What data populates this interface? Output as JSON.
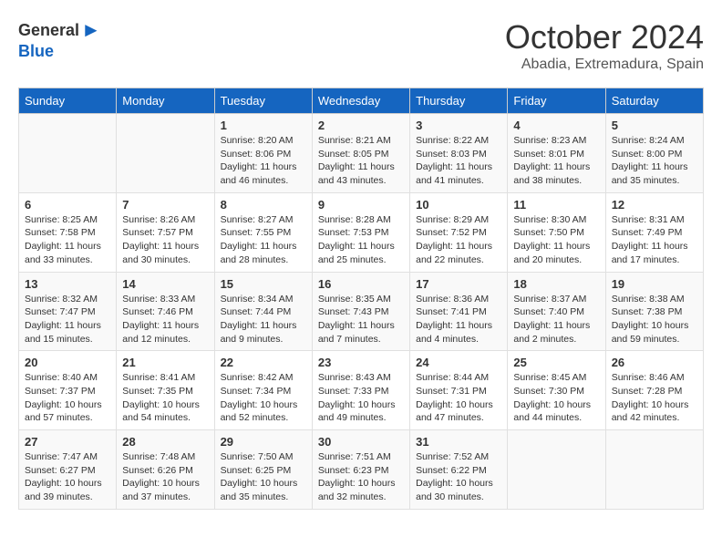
{
  "header": {
    "logo_general": "General",
    "logo_blue": "Blue",
    "month": "October 2024",
    "location": "Abadia, Extremadura, Spain"
  },
  "weekdays": [
    "Sunday",
    "Monday",
    "Tuesday",
    "Wednesday",
    "Thursday",
    "Friday",
    "Saturday"
  ],
  "weeks": [
    [
      {
        "day": "",
        "text": ""
      },
      {
        "day": "",
        "text": ""
      },
      {
        "day": "1",
        "text": "Sunrise: 8:20 AM\nSunset: 8:06 PM\nDaylight: 11 hours and 46 minutes."
      },
      {
        "day": "2",
        "text": "Sunrise: 8:21 AM\nSunset: 8:05 PM\nDaylight: 11 hours and 43 minutes."
      },
      {
        "day": "3",
        "text": "Sunrise: 8:22 AM\nSunset: 8:03 PM\nDaylight: 11 hours and 41 minutes."
      },
      {
        "day": "4",
        "text": "Sunrise: 8:23 AM\nSunset: 8:01 PM\nDaylight: 11 hours and 38 minutes."
      },
      {
        "day": "5",
        "text": "Sunrise: 8:24 AM\nSunset: 8:00 PM\nDaylight: 11 hours and 35 minutes."
      }
    ],
    [
      {
        "day": "6",
        "text": "Sunrise: 8:25 AM\nSunset: 7:58 PM\nDaylight: 11 hours and 33 minutes."
      },
      {
        "day": "7",
        "text": "Sunrise: 8:26 AM\nSunset: 7:57 PM\nDaylight: 11 hours and 30 minutes."
      },
      {
        "day": "8",
        "text": "Sunrise: 8:27 AM\nSunset: 7:55 PM\nDaylight: 11 hours and 28 minutes."
      },
      {
        "day": "9",
        "text": "Sunrise: 8:28 AM\nSunset: 7:53 PM\nDaylight: 11 hours and 25 minutes."
      },
      {
        "day": "10",
        "text": "Sunrise: 8:29 AM\nSunset: 7:52 PM\nDaylight: 11 hours and 22 minutes."
      },
      {
        "day": "11",
        "text": "Sunrise: 8:30 AM\nSunset: 7:50 PM\nDaylight: 11 hours and 20 minutes."
      },
      {
        "day": "12",
        "text": "Sunrise: 8:31 AM\nSunset: 7:49 PM\nDaylight: 11 hours and 17 minutes."
      }
    ],
    [
      {
        "day": "13",
        "text": "Sunrise: 8:32 AM\nSunset: 7:47 PM\nDaylight: 11 hours and 15 minutes."
      },
      {
        "day": "14",
        "text": "Sunrise: 8:33 AM\nSunset: 7:46 PM\nDaylight: 11 hours and 12 minutes."
      },
      {
        "day": "15",
        "text": "Sunrise: 8:34 AM\nSunset: 7:44 PM\nDaylight: 11 hours and 9 minutes."
      },
      {
        "day": "16",
        "text": "Sunrise: 8:35 AM\nSunset: 7:43 PM\nDaylight: 11 hours and 7 minutes."
      },
      {
        "day": "17",
        "text": "Sunrise: 8:36 AM\nSunset: 7:41 PM\nDaylight: 11 hours and 4 minutes."
      },
      {
        "day": "18",
        "text": "Sunrise: 8:37 AM\nSunset: 7:40 PM\nDaylight: 11 hours and 2 minutes."
      },
      {
        "day": "19",
        "text": "Sunrise: 8:38 AM\nSunset: 7:38 PM\nDaylight: 10 hours and 59 minutes."
      }
    ],
    [
      {
        "day": "20",
        "text": "Sunrise: 8:40 AM\nSunset: 7:37 PM\nDaylight: 10 hours and 57 minutes."
      },
      {
        "day": "21",
        "text": "Sunrise: 8:41 AM\nSunset: 7:35 PM\nDaylight: 10 hours and 54 minutes."
      },
      {
        "day": "22",
        "text": "Sunrise: 8:42 AM\nSunset: 7:34 PM\nDaylight: 10 hours and 52 minutes."
      },
      {
        "day": "23",
        "text": "Sunrise: 8:43 AM\nSunset: 7:33 PM\nDaylight: 10 hours and 49 minutes."
      },
      {
        "day": "24",
        "text": "Sunrise: 8:44 AM\nSunset: 7:31 PM\nDaylight: 10 hours and 47 minutes."
      },
      {
        "day": "25",
        "text": "Sunrise: 8:45 AM\nSunset: 7:30 PM\nDaylight: 10 hours and 44 minutes."
      },
      {
        "day": "26",
        "text": "Sunrise: 8:46 AM\nSunset: 7:28 PM\nDaylight: 10 hours and 42 minutes."
      }
    ],
    [
      {
        "day": "27",
        "text": "Sunrise: 7:47 AM\nSunset: 6:27 PM\nDaylight: 10 hours and 39 minutes."
      },
      {
        "day": "28",
        "text": "Sunrise: 7:48 AM\nSunset: 6:26 PM\nDaylight: 10 hours and 37 minutes."
      },
      {
        "day": "29",
        "text": "Sunrise: 7:50 AM\nSunset: 6:25 PM\nDaylight: 10 hours and 35 minutes."
      },
      {
        "day": "30",
        "text": "Sunrise: 7:51 AM\nSunset: 6:23 PM\nDaylight: 10 hours and 32 minutes."
      },
      {
        "day": "31",
        "text": "Sunrise: 7:52 AM\nSunset: 6:22 PM\nDaylight: 10 hours and 30 minutes."
      },
      {
        "day": "",
        "text": ""
      },
      {
        "day": "",
        "text": ""
      }
    ]
  ]
}
